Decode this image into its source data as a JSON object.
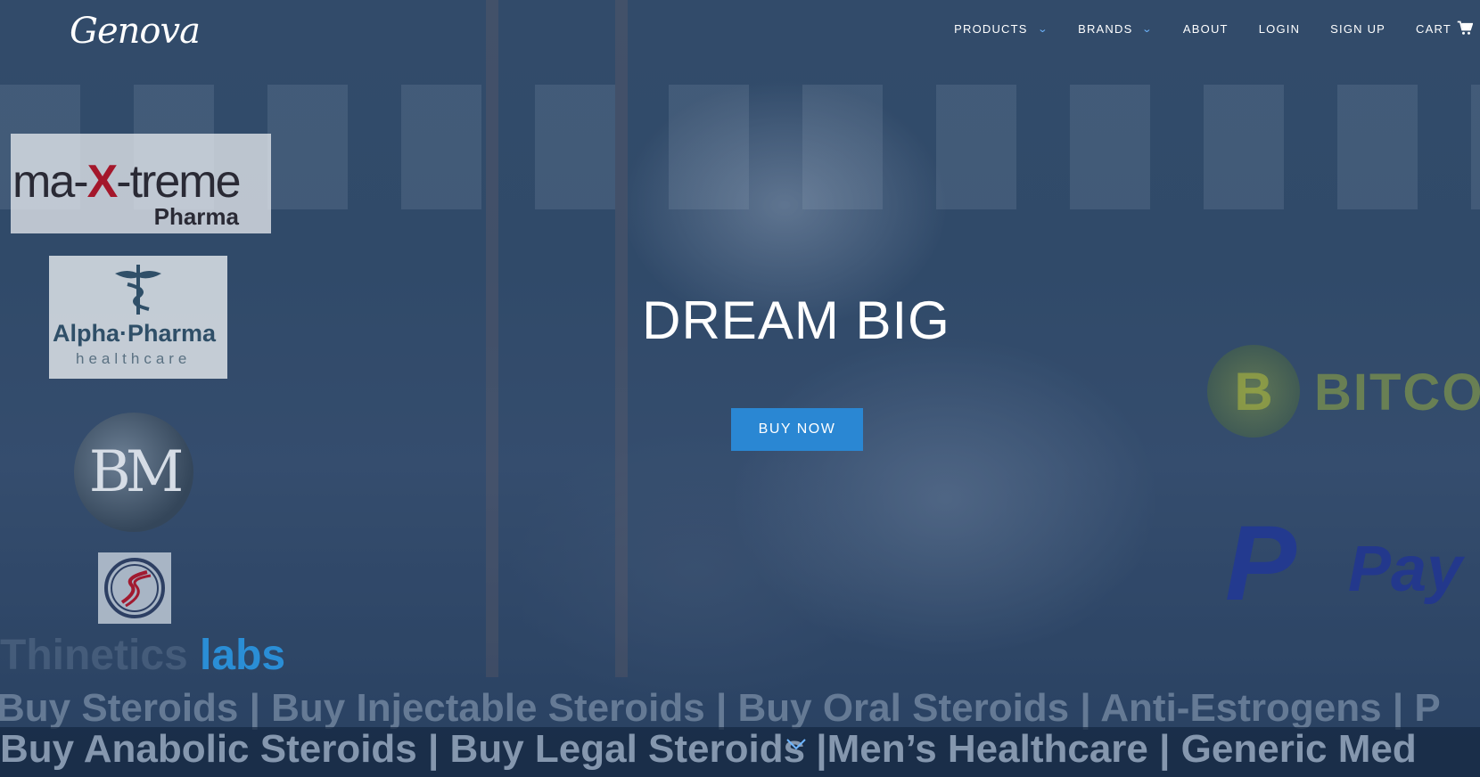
{
  "brand": {
    "logo_text": "Genova"
  },
  "nav": {
    "items": [
      {
        "label": "PRODUCTS",
        "has_dropdown": true
      },
      {
        "label": "BRANDS",
        "has_dropdown": true
      },
      {
        "label": "ABOUT",
        "has_dropdown": false
      },
      {
        "label": "LOGIN",
        "has_dropdown": false
      },
      {
        "label": "SIGN UP",
        "has_dropdown": false
      },
      {
        "label": "CART",
        "has_dropdown": false,
        "icon": "cart-icon"
      }
    ]
  },
  "hero": {
    "headline": "DREAM BIG",
    "cta_label": "BUY NOW",
    "cta_color": "#2a87d3"
  },
  "logos": {
    "maxtreme": {
      "line1_pre": "ma-",
      "line1_x": "X",
      "line1_post": "-treme",
      "line2": "Pharma"
    },
    "alpha": {
      "line1": "Alpha·Pharma",
      "line2": "healthcare"
    },
    "bm": {
      "text": "BM"
    },
    "labs": {
      "dim_text": "Thinetics ",
      "bright_text": "labs"
    },
    "bitcoin": {
      "symbol": "B",
      "text": "BITCO"
    },
    "paypal": {
      "mark": "P",
      "text": "Pay"
    }
  },
  "marquee": {
    "line1": "Buy Steroids  |  Buy Injectable Steroids  |  Buy Oral Steroids  |  Anti-Estrogens  |  P",
    "line2": "Buy Anabolic Steroids  |  Buy Legal Steroids  |Men’s Healthcare  |  Generic Med"
  },
  "colors": {
    "accent": "#2a87d3",
    "chevron": "#6fb6ff"
  }
}
